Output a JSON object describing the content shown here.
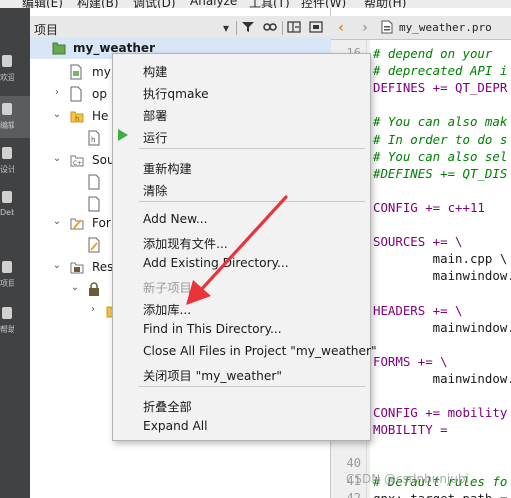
{
  "menubar": {
    "items": [
      "编辑(E)",
      "构建(B)",
      "调试(D)",
      "Analyze",
      "工具(T)",
      "控件(W)",
      "帮助(H)"
    ]
  },
  "modebar": {
    "items": [
      {
        "label": "欢迎",
        "icon": "grid-icon"
      },
      {
        "label": "编辑",
        "icon": "edit-icon"
      },
      {
        "label": "设计",
        "icon": "pencil-icon"
      },
      {
        "label": "Debug",
        "icon": "bug-icon"
      },
      {
        "label": "项目",
        "icon": "wrench-icon"
      },
      {
        "label": "帮助",
        "icon": "help-icon"
      }
    ]
  },
  "project_pane": {
    "title": "项目",
    "tree": [
      {
        "label": "my_weather",
        "bold": true
      },
      {
        "label": "my"
      },
      {
        "label": "op"
      },
      {
        "label": "He"
      },
      {
        "label": ""
      },
      {
        "label": "Sou"
      },
      {
        "label": ""
      },
      {
        "label": ""
      },
      {
        "label": "For"
      },
      {
        "label": ""
      },
      {
        "label": "Res"
      },
      {
        "label": ""
      },
      {
        "label": ""
      }
    ]
  },
  "editor": {
    "filename": "my_weather.pro",
    "line_numbers": [
      "16",
      "17",
      "",
      "",
      "",
      "",
      "",
      "",
      "",
      "",
      "",
      "",
      "",
      "",
      "",
      "",
      "",
      "",
      "",
      "",
      "",
      "40",
      "41",
      "42"
    ],
    "lines": [
      {
        "text": "# depend on your",
        "kind": "comment"
      },
      {
        "text": "# deprecated API i",
        "kind": "comment"
      },
      {
        "text": "DEFINES += QT_DEPR",
        "kind": "var"
      },
      {
        "text": "",
        "kind": "plain"
      },
      {
        "text": "# You can also mak",
        "kind": "comment"
      },
      {
        "text": "# In order to do s",
        "kind": "comment"
      },
      {
        "text": "# You can also sel",
        "kind": "comment"
      },
      {
        "text": "#DEFINES += QT_DIS",
        "kind": "comment"
      },
      {
        "text": "",
        "kind": "plain"
      },
      {
        "text": "CONFIG += c++11",
        "kind": "var"
      },
      {
        "text": "",
        "kind": "plain"
      },
      {
        "text": "SOURCES += \\",
        "kind": "var"
      },
      {
        "text": "        main.cpp \\",
        "kind": "plain"
      },
      {
        "text": "        mainwindow.",
        "kind": "plain"
      },
      {
        "text": "",
        "kind": "plain"
      },
      {
        "text": "HEADERS += \\",
        "kind": "var"
      },
      {
        "text": "        mainwindow.",
        "kind": "plain"
      },
      {
        "text": "",
        "kind": "plain"
      },
      {
        "text": "FORMS += \\",
        "kind": "var"
      },
      {
        "text": "        mainwindow.",
        "kind": "plain"
      },
      {
        "text": "",
        "kind": "plain"
      },
      {
        "text": "CONFIG += mobility",
        "kind": "var"
      },
      {
        "text": "MOBILITY =",
        "kind": "var"
      },
      {
        "text": "",
        "kind": "plain"
      },
      {
        "text": "",
        "kind": "plain"
      },
      {
        "text": "# Default rules fo",
        "kind": "comment"
      },
      {
        "text": "qnx: target.path =",
        "kind": "plain"
      }
    ]
  },
  "context_menu": {
    "items": [
      {
        "label": "构建",
        "type": "item"
      },
      {
        "label": "执行qmake",
        "type": "item"
      },
      {
        "label": "部署",
        "type": "item"
      },
      {
        "label": "运行",
        "type": "item",
        "icon": "run-icon"
      },
      {
        "type": "separator"
      },
      {
        "label": "重新构建",
        "type": "item"
      },
      {
        "label": "清除",
        "type": "item"
      },
      {
        "type": "separator"
      },
      {
        "label": "Add New...",
        "type": "item"
      },
      {
        "label": "添加现有文件...",
        "type": "item"
      },
      {
        "label": "Add Existing Directory...",
        "type": "item"
      },
      {
        "label": "新子项目...",
        "type": "disabled"
      },
      {
        "label": "添加库...",
        "type": "item"
      },
      {
        "label": "Find in This Directory...",
        "type": "item"
      },
      {
        "label": "Close All Files in Project \"my_weather\"",
        "type": "item"
      },
      {
        "label": "关闭项目 \"my_weather\"",
        "type": "item"
      },
      {
        "type": "separator"
      },
      {
        "label": "折叠全部",
        "type": "item"
      },
      {
        "label": "Expand All",
        "type": "item"
      }
    ]
  },
  "annotation": {
    "color": "#e8343a",
    "target": "添加库..."
  },
  "watermark": "CSDN @csdnbunjubi",
  "colors": {
    "selection": "#d8e6f7",
    "modebar": "#404244",
    "run_green": "#3fad3f",
    "comment": "#008000",
    "keyword": "#800080"
  }
}
